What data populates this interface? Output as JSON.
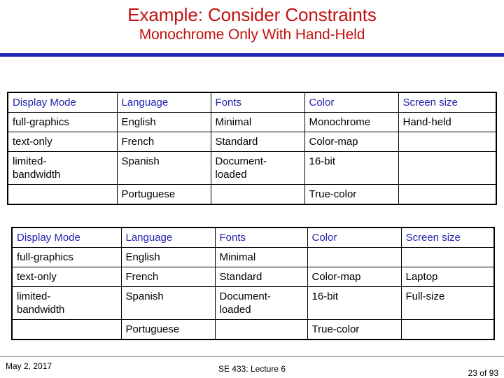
{
  "slide": {
    "title_line1": "Example: Consider Constraints",
    "title_line2": "Monochrome Only With Hand-Held",
    "title_color": "#C21111",
    "rule_color": "#2222B0",
    "header_text_color": "#2222B0",
    "body_text_color": "#000000"
  },
  "table_one": {
    "headers": [
      "Display Mode",
      "Language",
      "Fonts",
      "Color",
      "Screen size"
    ],
    "rows": [
      [
        "full-graphics",
        "English",
        "Minimal",
        "Monochrome",
        "Hand-held"
      ],
      [
        "text-only",
        "French",
        "Standard",
        "Color-map",
        ""
      ],
      [
        "limited-\nbandwidth",
        "Spanish",
        "Document-\nloaded",
        "16-bit",
        ""
      ],
      [
        "",
        "Portuguese",
        "",
        "True-color",
        ""
      ]
    ]
  },
  "table_two": {
    "headers": [
      "Display Mode",
      "Language",
      "Fonts",
      "Color",
      "Screen size"
    ],
    "rows": [
      [
        "full-graphics",
        "English",
        "Minimal",
        "",
        ""
      ],
      [
        "text-only",
        "French",
        "Standard",
        "Color-map",
        "Laptop"
      ],
      [
        "limited-\nbandwidth",
        "Spanish",
        "Document-\nloaded",
        "16-bit",
        "Full-size"
      ],
      [
        "",
        "Portuguese",
        "",
        "True-color",
        ""
      ]
    ]
  },
  "footer": {
    "date": "May 2, 2017",
    "center": "SE 433: Lecture 6",
    "page": "23 of 93"
  }
}
